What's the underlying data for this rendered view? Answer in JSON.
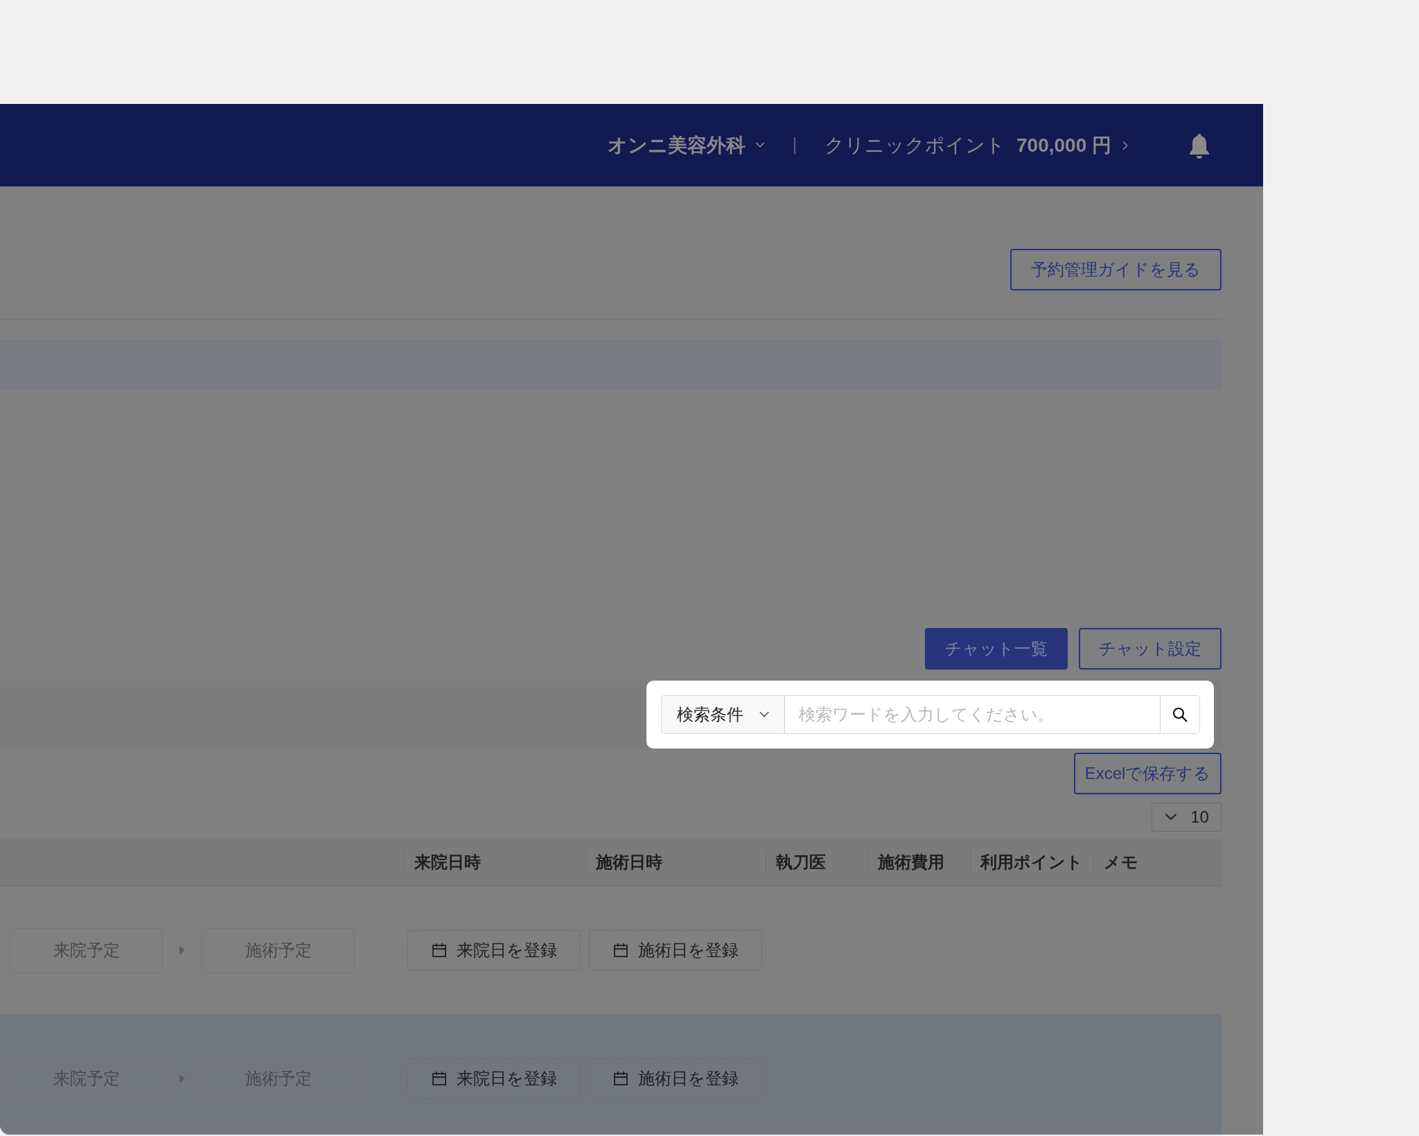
{
  "header": {
    "clinic_name": "オンニ美容外科",
    "points_label": "クリニックポイント",
    "points_value": "700,000 円"
  },
  "guide_button": "予約管理ガイドを見る",
  "chat_buttons": [
    {
      "label": "チャット一覧",
      "selected": true
    },
    {
      "label": "チャット設定",
      "selected": false
    }
  ],
  "search": {
    "condition": "検索条件",
    "placeholder": "検索ワードを入力してください。"
  },
  "excel_button": "Excelで保存する",
  "page_size": "10",
  "table": {
    "columns": [
      "来院日時",
      "施術日時",
      "執刀医",
      "施術費用",
      "利用ポイント",
      "メモ"
    ],
    "rows": [
      {
        "visit_status": "来院予定",
        "treatment_status": "施術予定",
        "visit_button": "来院日を登録",
        "treatment_button": "施術日を登録",
        "highlighted": false
      },
      {
        "visit_status": "来院予定",
        "treatment_status": "施術予定",
        "visit_button": "来院日を登録",
        "treatment_button": "施術日を登録",
        "highlighted": true
      }
    ]
  }
}
